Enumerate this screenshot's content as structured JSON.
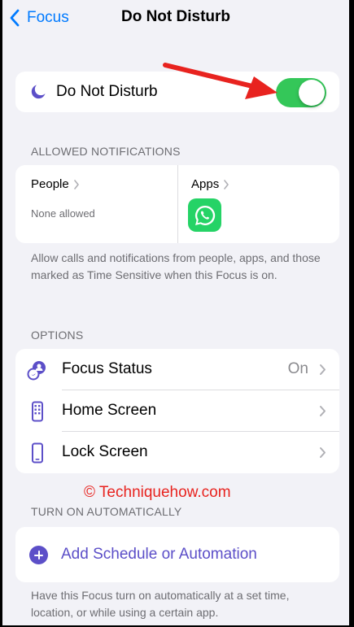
{
  "nav": {
    "back_label": "Focus",
    "title": "Do Not Disturb"
  },
  "dnd": {
    "label": "Do Not Disturb",
    "toggle_on": true,
    "toggle_color": "#34c759"
  },
  "allowed": {
    "header": "ALLOWED NOTIFICATIONS",
    "people_label": "People",
    "people_value": "None allowed",
    "apps_label": "Apps",
    "apps": [
      "whatsapp-icon"
    ],
    "footer": "Allow calls and notifications from people, apps, and those marked as Time Sensitive when this Focus is on."
  },
  "options": {
    "header": "OPTIONS",
    "items": [
      {
        "label": "Focus Status",
        "value": "On",
        "icon": "focus-status-icon"
      },
      {
        "label": "Home Screen",
        "value": "",
        "icon": "home-screen-icon"
      },
      {
        "label": "Lock Screen",
        "value": "",
        "icon": "lock-screen-icon"
      }
    ]
  },
  "watermark": "© Techniquehow.com",
  "automation": {
    "header": "TURN ON AUTOMATICALLY",
    "add_label": "Add Schedule or Automation",
    "footer": "Have this Focus turn on automatically at a set time, location, or while using a certain app."
  },
  "colors": {
    "accent": "#007aff",
    "focus_purple": "#5c4fc8",
    "annotation_red": "#e8231f"
  }
}
